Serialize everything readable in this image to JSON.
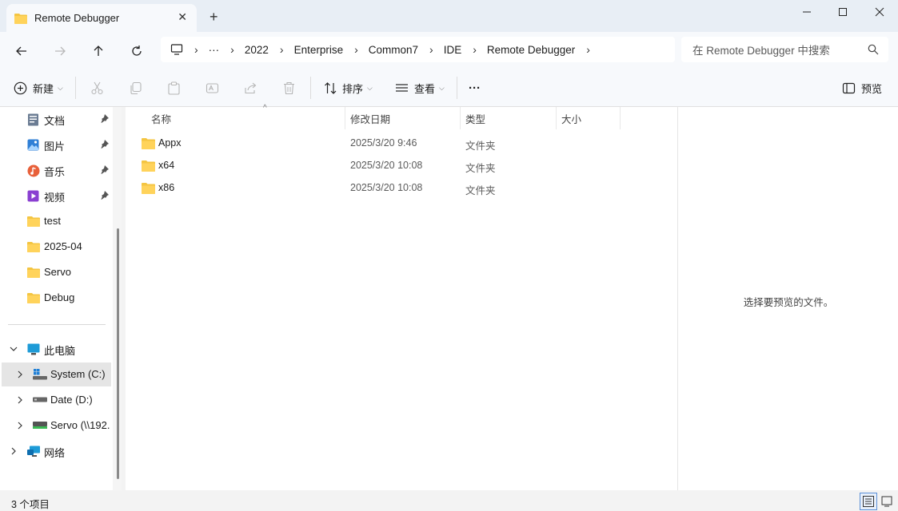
{
  "tab": {
    "title": "Remote Debugger",
    "close": "✕"
  },
  "window": {
    "minimize": "—",
    "maximize": "□",
    "close": "✕"
  },
  "breadcrumb": {
    "overflow": "···",
    "items": [
      "2022",
      "Enterprise",
      "Common7",
      "IDE",
      "Remote Debugger"
    ]
  },
  "search": {
    "placeholder": "在 Remote Debugger 中搜索"
  },
  "toolbar": {
    "new_label": "新建",
    "sort_label": "排序",
    "view_label": "查看",
    "more_label": "···",
    "preview_label": "预览"
  },
  "sidebar": {
    "quick": [
      {
        "label": "文档",
        "icon": "documents-icon",
        "pinned": true
      },
      {
        "label": "图片",
        "icon": "pictures-icon",
        "pinned": true
      },
      {
        "label": "音乐",
        "icon": "music-icon",
        "pinned": true
      },
      {
        "label": "视频",
        "icon": "videos-icon",
        "pinned": true
      },
      {
        "label": "test",
        "icon": "folder-icon",
        "pinned": false
      },
      {
        "label": "2025-04",
        "icon": "folder-icon",
        "pinned": false
      },
      {
        "label": "Servo",
        "icon": "folder-icon",
        "pinned": false
      },
      {
        "label": "Debug",
        "icon": "folder-icon",
        "pinned": false
      }
    ],
    "this_pc": "此电脑",
    "drives": [
      {
        "label": "System (C:)",
        "icon": "windows-drive-icon"
      },
      {
        "label": "Date (D:)",
        "icon": "drive-icon"
      },
      {
        "label": "Servo (\\\\192.",
        "icon": "network-drive-icon"
      }
    ],
    "network": "网络"
  },
  "columns": {
    "name": "名称",
    "modified": "修改日期",
    "type": "类型",
    "size": "大小"
  },
  "files": [
    {
      "name": "Appx",
      "modified": "2025/3/20 9:46",
      "type": "文件夹"
    },
    {
      "name": "x64",
      "modified": "2025/3/20 10:08",
      "type": "文件夹"
    },
    {
      "name": "x86",
      "modified": "2025/3/20 10:08",
      "type": "文件夹"
    }
  ],
  "preview": {
    "message": "选择要预览的文件。"
  },
  "status": {
    "count": "3 个项目"
  },
  "colors": {
    "folder": "#f4c542",
    "accent": "#0067c0",
    "selection": "#e5e5e5"
  }
}
